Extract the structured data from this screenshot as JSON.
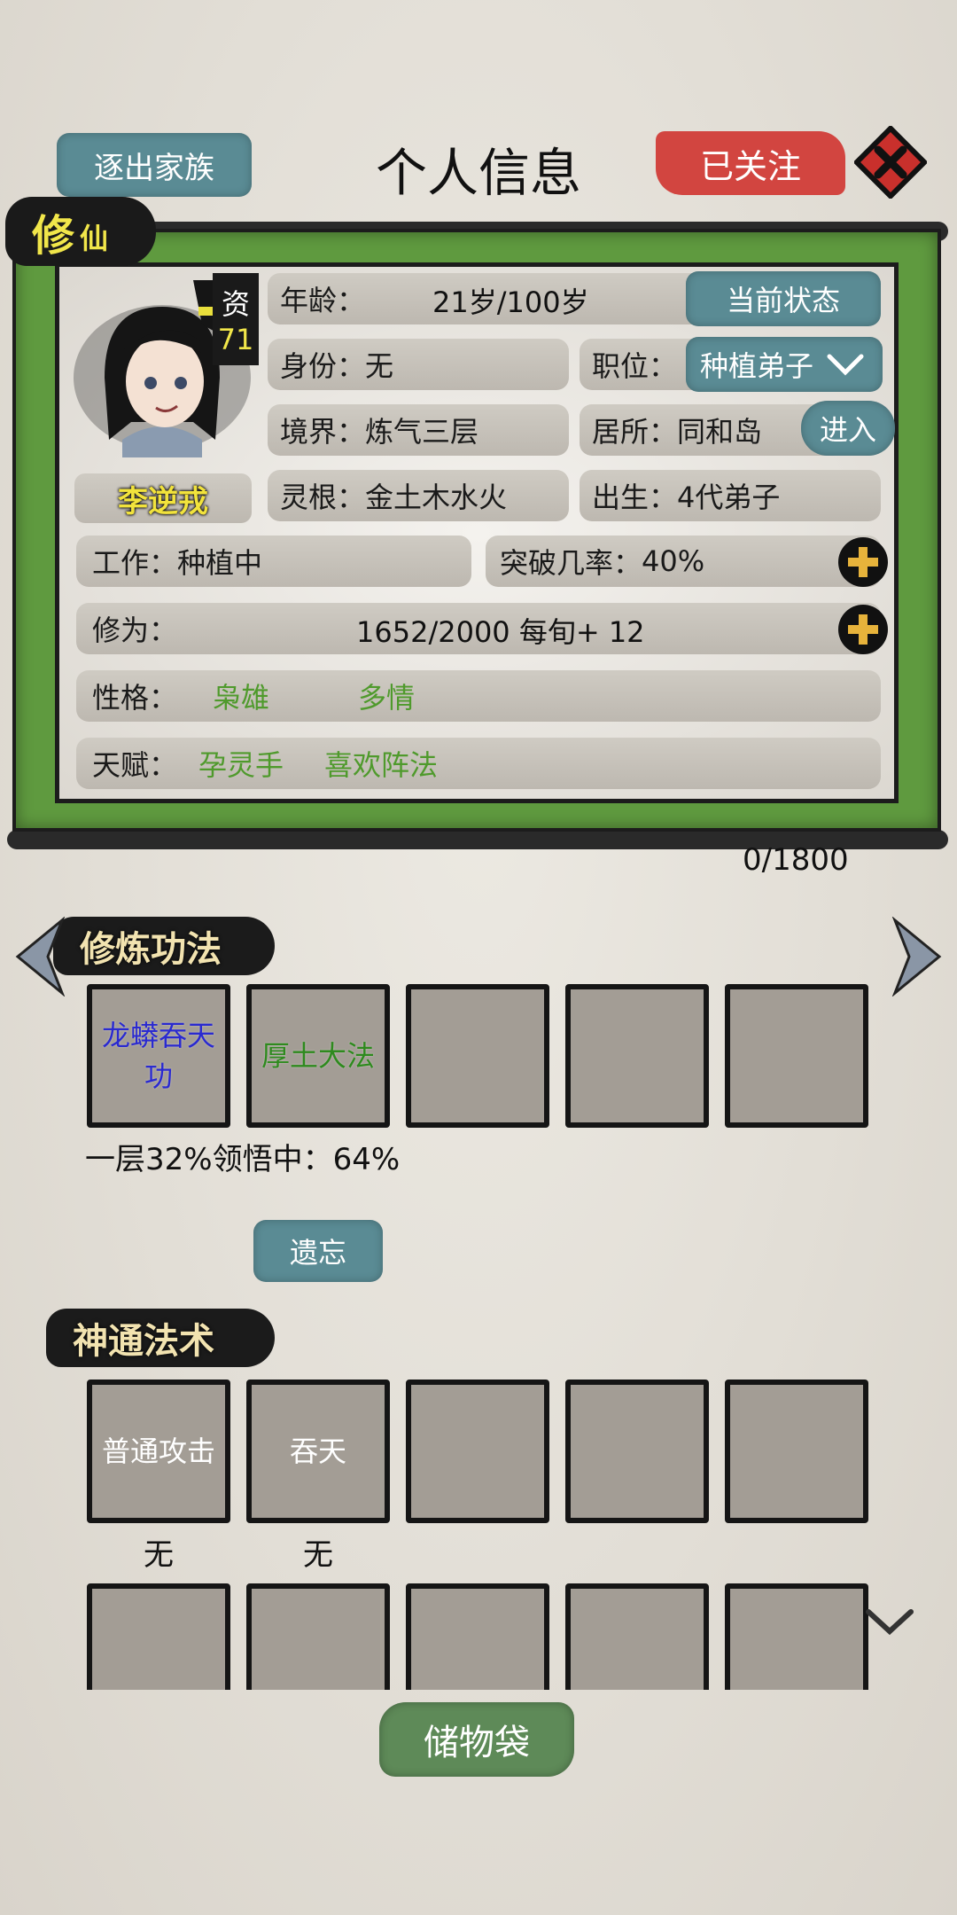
{
  "header": {
    "title": "个人信息",
    "expel_label": "逐出家族",
    "follow_label": "已关注"
  },
  "card": {
    "tag_main": "修",
    "tag_sub": "仙",
    "aptitude_label": "资",
    "aptitude_value": "71",
    "name": "李逆戎",
    "age_label": "年龄：",
    "age_value": "21岁/100岁",
    "status_button": "当前状态",
    "identity_label": "身份：",
    "identity_value": "无",
    "position_label": "职位：",
    "position_value": "种植弟子",
    "realm_label": "境界：",
    "realm_value": "炼气三层",
    "residence_label": "居所：",
    "residence_value": "同和岛",
    "enter_button": "进入",
    "root_label": "灵根：",
    "root_value": "金土木水火",
    "birth_label": "出生：",
    "birth_value": "4代弟子",
    "work_label": "工作：",
    "work_value": "种植中",
    "breakthrough_label": "突破几率：",
    "breakthrough_value": "40%",
    "cultivation_label": "修为：",
    "cultivation_value": "1652/2000  每旬+ 12",
    "personality_label": "性格：",
    "personality": [
      "枭雄",
      "多情"
    ],
    "talent_label": "天赋：",
    "talents": [
      "孕灵手",
      "喜欢阵法"
    ]
  },
  "counter": "0/1800",
  "techniques": {
    "title": "修炼功法",
    "slots": [
      {
        "label": "龙蟒吞天功",
        "color": "#2a2ad0"
      },
      {
        "label": "厚土大法",
        "color": "#2e8a1e"
      },
      {
        "label": ""
      },
      {
        "label": ""
      },
      {
        "label": ""
      }
    ],
    "progress": "一层32%领悟中：64%",
    "forget_label": "遗忘"
  },
  "skills": {
    "title": "神通法术",
    "slots": [
      {
        "label": "普通攻击",
        "sub": "无"
      },
      {
        "label": "吞天",
        "sub": "无"
      },
      {
        "label": "",
        "sub": ""
      },
      {
        "label": "",
        "sub": ""
      },
      {
        "label": "",
        "sub": ""
      }
    ]
  },
  "storage_label": "储物袋",
  "colors": {
    "scroll_green": "#5f9a3f",
    "follow_red": "#d24540",
    "button_teal": "#5a8b94",
    "storage_green": "#5e8a58"
  },
  "icons": [
    "close-icon",
    "chevron-down-icon",
    "plus-icon",
    "arrow-left-icon",
    "arrow-right-icon",
    "character-portrait"
  ]
}
